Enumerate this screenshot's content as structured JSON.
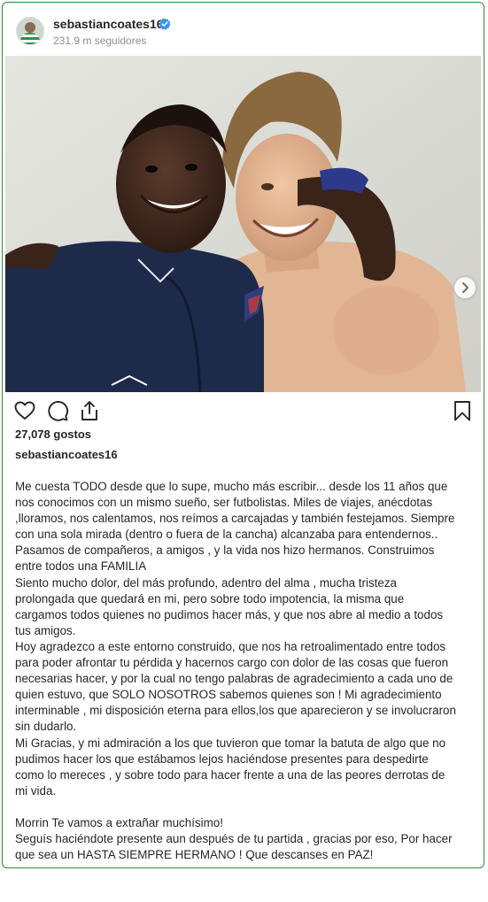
{
  "post": {
    "username": "sebastiancoates16",
    "followers": "231.9 m seguidores",
    "likes": "27,078 gostos",
    "caption_author": "sebastiancoates16",
    "caption_lines": [
      "Me cuesta TODO desde que lo supe, mucho más escribir... desde los 11 años que",
      "nos conocimos con un mismo sueño, ser futbolistas. Miles de viajes, anécdotas",
      ",lloramos, nos calentamos, nos reímos a carcajadas y también festejamos. Siempre",
      "con una sola mirada (dentro o fuera de la cancha) alcanzaba para entendernos..",
      "Pasamos de compañeros, a amigos , y la vida nos hizo hermanos. Construimos",
      "entre todos una FAMILIA",
      "Siento mucho dolor, del más profundo, adentro del alma , mucha tristeza",
      "prolongada que quedará en mi, pero sobre todo impotencia, la misma que",
      "cargamos todos quienes no pudimos hacer más, y que nos abre al medio a todos",
      "tus amigos.",
      "Hoy agradezco a este entorno construido, que nos ha retroalimentado entre todos",
      "para poder afrontar tu pérdida y hacernos cargo con dolor de las cosas que fueron",
      "necesarias hacer, y por la cual no tengo palabras de agradecimiento a cada uno de",
      "quien estuvo, que SOLO NOSOTROS sabemos quienes son ! Mi agradecimiento",
      "interminable , mi disposición eterna para ellos,los que aparecieron y se involucraron",
      "sin dudarlo.",
      "Mi Gracias, y mi admiración a los que tuvieron que tomar la batuta de algo que no",
      "pudimos hacer los que estábamos lejos haciéndose presentes para despedirte",
      "como lo mereces , y sobre todo para hacer frente a una de las peores derrotas de",
      "mi vida.",
      "",
      "Morrin Te vamos a extrañar muchísimo!",
      "Seguís haciéndote presente aun después de tu partida , gracias por eso, Por hacer",
      "que sea un HASTA SIEMPRE HERMANO ! Que descanses en PAZ!"
    ]
  },
  "icons": {
    "verified": "verified-badge-icon",
    "like": "heart-icon",
    "comment": "comment-icon",
    "share": "share-icon",
    "save": "bookmark-icon",
    "next": "chevron-right-icon"
  },
  "colors": {
    "frame": "#2e8b3a",
    "verified": "#3897f0",
    "jacket": "#1e2a4a"
  }
}
